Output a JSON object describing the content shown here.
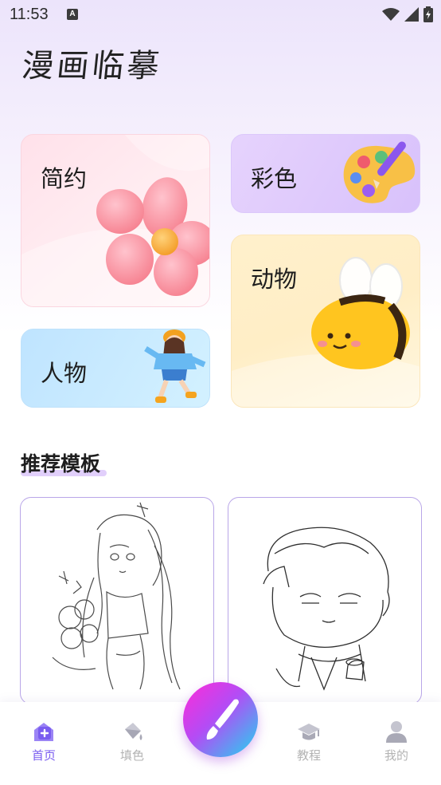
{
  "status_bar": {
    "time": "11:53",
    "notification_letter": "A"
  },
  "app": {
    "title": "漫画临摹"
  },
  "categories": [
    {
      "label": "简约",
      "icon": "flower-icon"
    },
    {
      "label": "彩色",
      "icon": "palette-icon"
    },
    {
      "label": "动物",
      "icon": "bee-icon"
    },
    {
      "label": "人物",
      "icon": "girl-figure-icon"
    }
  ],
  "recommend": {
    "title": "推荐模板",
    "templates": [
      {
        "icon": "anime-girl-sketch"
      },
      {
        "icon": "chibi-boy-sketch"
      }
    ]
  },
  "tab_bar": {
    "tabs": [
      {
        "label": "首页",
        "icon": "home-icon",
        "active": true
      },
      {
        "label": "填色",
        "icon": "paint-bucket-icon",
        "active": false
      },
      {
        "label": "教程",
        "icon": "graduation-cap-icon",
        "active": false
      },
      {
        "label": "我的",
        "icon": "user-icon",
        "active": false
      }
    ],
    "center_button_icon": "brush-icon"
  },
  "colors": {
    "accent": "#7a5cf0",
    "inactive": "#b3b3b3"
  }
}
